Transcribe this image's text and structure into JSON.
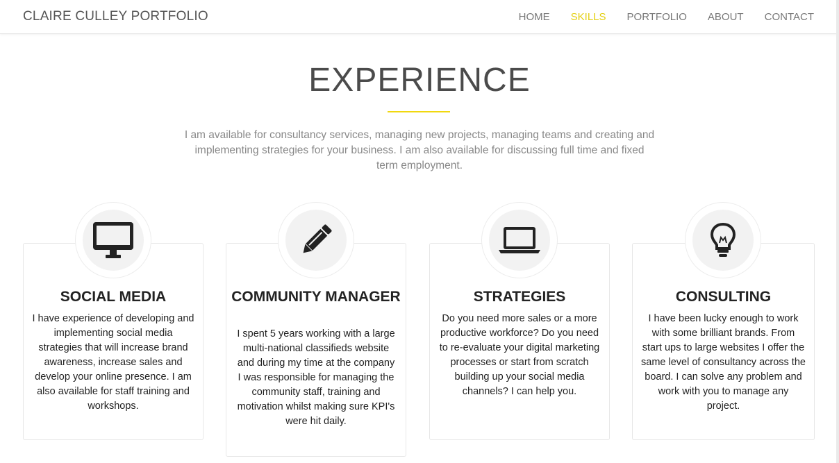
{
  "nav": {
    "brand": "CLAIRE CULLEY PORTFOLIO",
    "items": [
      {
        "label": "HOME",
        "active": false
      },
      {
        "label": "SKILLS",
        "active": true
      },
      {
        "label": "PORTFOLIO",
        "active": false
      },
      {
        "label": "ABOUT",
        "active": false
      },
      {
        "label": "CONTACT",
        "active": false
      }
    ],
    "active_color": "#e4cf11"
  },
  "section": {
    "title": "EXPERIENCE",
    "intro": "I am available for consultancy services, managing new projects, managing teams and creating and implementing strategies for your business. I am also available for discussing full time and fixed term employment."
  },
  "cards": [
    {
      "icon": "monitor-icon",
      "title": "SOCIAL MEDIA",
      "text": "I have experience of developing and implementing social media strategies that will increase brand awareness, increase sales and develop your online presence. I am also available for staff training and workshops."
    },
    {
      "icon": "pencil-icon",
      "title": "COMMUNITY MANAGER",
      "text": "I spent 5 years working with a large multi-national classifieds website and during my time at the company I was responsible for managing the community staff, training and motivation whilst making sure KPI's were hit daily."
    },
    {
      "icon": "laptop-icon",
      "title": "STRATEGIES",
      "text": "Do you need more sales or a more productive workforce? Do you need to re-evaluate your digital marketing processes or start from scratch building up your social media channels? I can help you."
    },
    {
      "icon": "lightbulb-icon",
      "title": "CONSULTING",
      "text": "I have been lucky enough to work with some brilliant brands. From start ups to large websites I offer the same level of consultancy across the board. I can solve any problem and work with you to manage any project."
    }
  ]
}
